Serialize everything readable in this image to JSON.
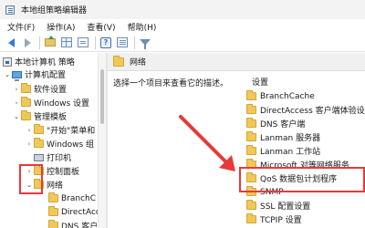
{
  "window": {
    "title": "本地组策略编辑器"
  },
  "menu": [
    "文件(F)",
    "操作(A)",
    "查看(V)",
    "帮助(H)"
  ],
  "toolbar_icons": [
    "back-arrow-icon",
    "forward-arrow-icon",
    "folder-up-icon",
    "show-hide-tree-icon",
    "export-list-icon",
    "help-icon",
    "properties-icon",
    "filter-icon"
  ],
  "tree": {
    "items": [
      {
        "label": "本地计算机 策略",
        "icon": "policy-icon",
        "caret": ""
      },
      {
        "label": "计算机配置",
        "icon": "computer-icon",
        "caret": "down"
      },
      {
        "label": "软件设置",
        "icon": "folder-icon",
        "caret": "right"
      },
      {
        "label": "Windows 设置",
        "icon": "folder-icon",
        "caret": "right"
      },
      {
        "label": "管理模板",
        "icon": "folder-icon",
        "caret": "down"
      },
      {
        "label": "\"开始\"菜单和",
        "icon": "folder-icon",
        "caret": "right"
      },
      {
        "label": "Windows 组",
        "icon": "folder-icon",
        "caret": "right"
      },
      {
        "label": "打印机",
        "icon": "printer-icon",
        "caret": ""
      },
      {
        "label": "控制面板",
        "icon": "folder-icon",
        "caret": "right"
      },
      {
        "label": "网络",
        "icon": "folder-icon",
        "caret": "down"
      },
      {
        "label": "BranchC",
        "icon": "folder-icon",
        "caret": ""
      },
      {
        "label": "DirectAcc",
        "icon": "folder-icon",
        "caret": ""
      },
      {
        "label": "DNS 客户",
        "icon": "folder-icon",
        "caret": ""
      }
    ]
  },
  "right": {
    "header_title": "网络",
    "description": "选择一个项目来查看它的描述。",
    "list_header": "设置",
    "items": [
      "BranchCache",
      "DirectAccess 客户端体验设置",
      "DNS 客户端",
      "Lanman 服务器",
      "Lanman 工作站",
      "Microsoft 对等网络服务",
      "QoS 数据包计划程序",
      "SNMP",
      "SSL 配置设置",
      "TCPIP 设置"
    ]
  },
  "colors": {
    "annotation": "#e8393a",
    "folder": "#f0c85a",
    "header_bg": "#f0f0f0"
  }
}
